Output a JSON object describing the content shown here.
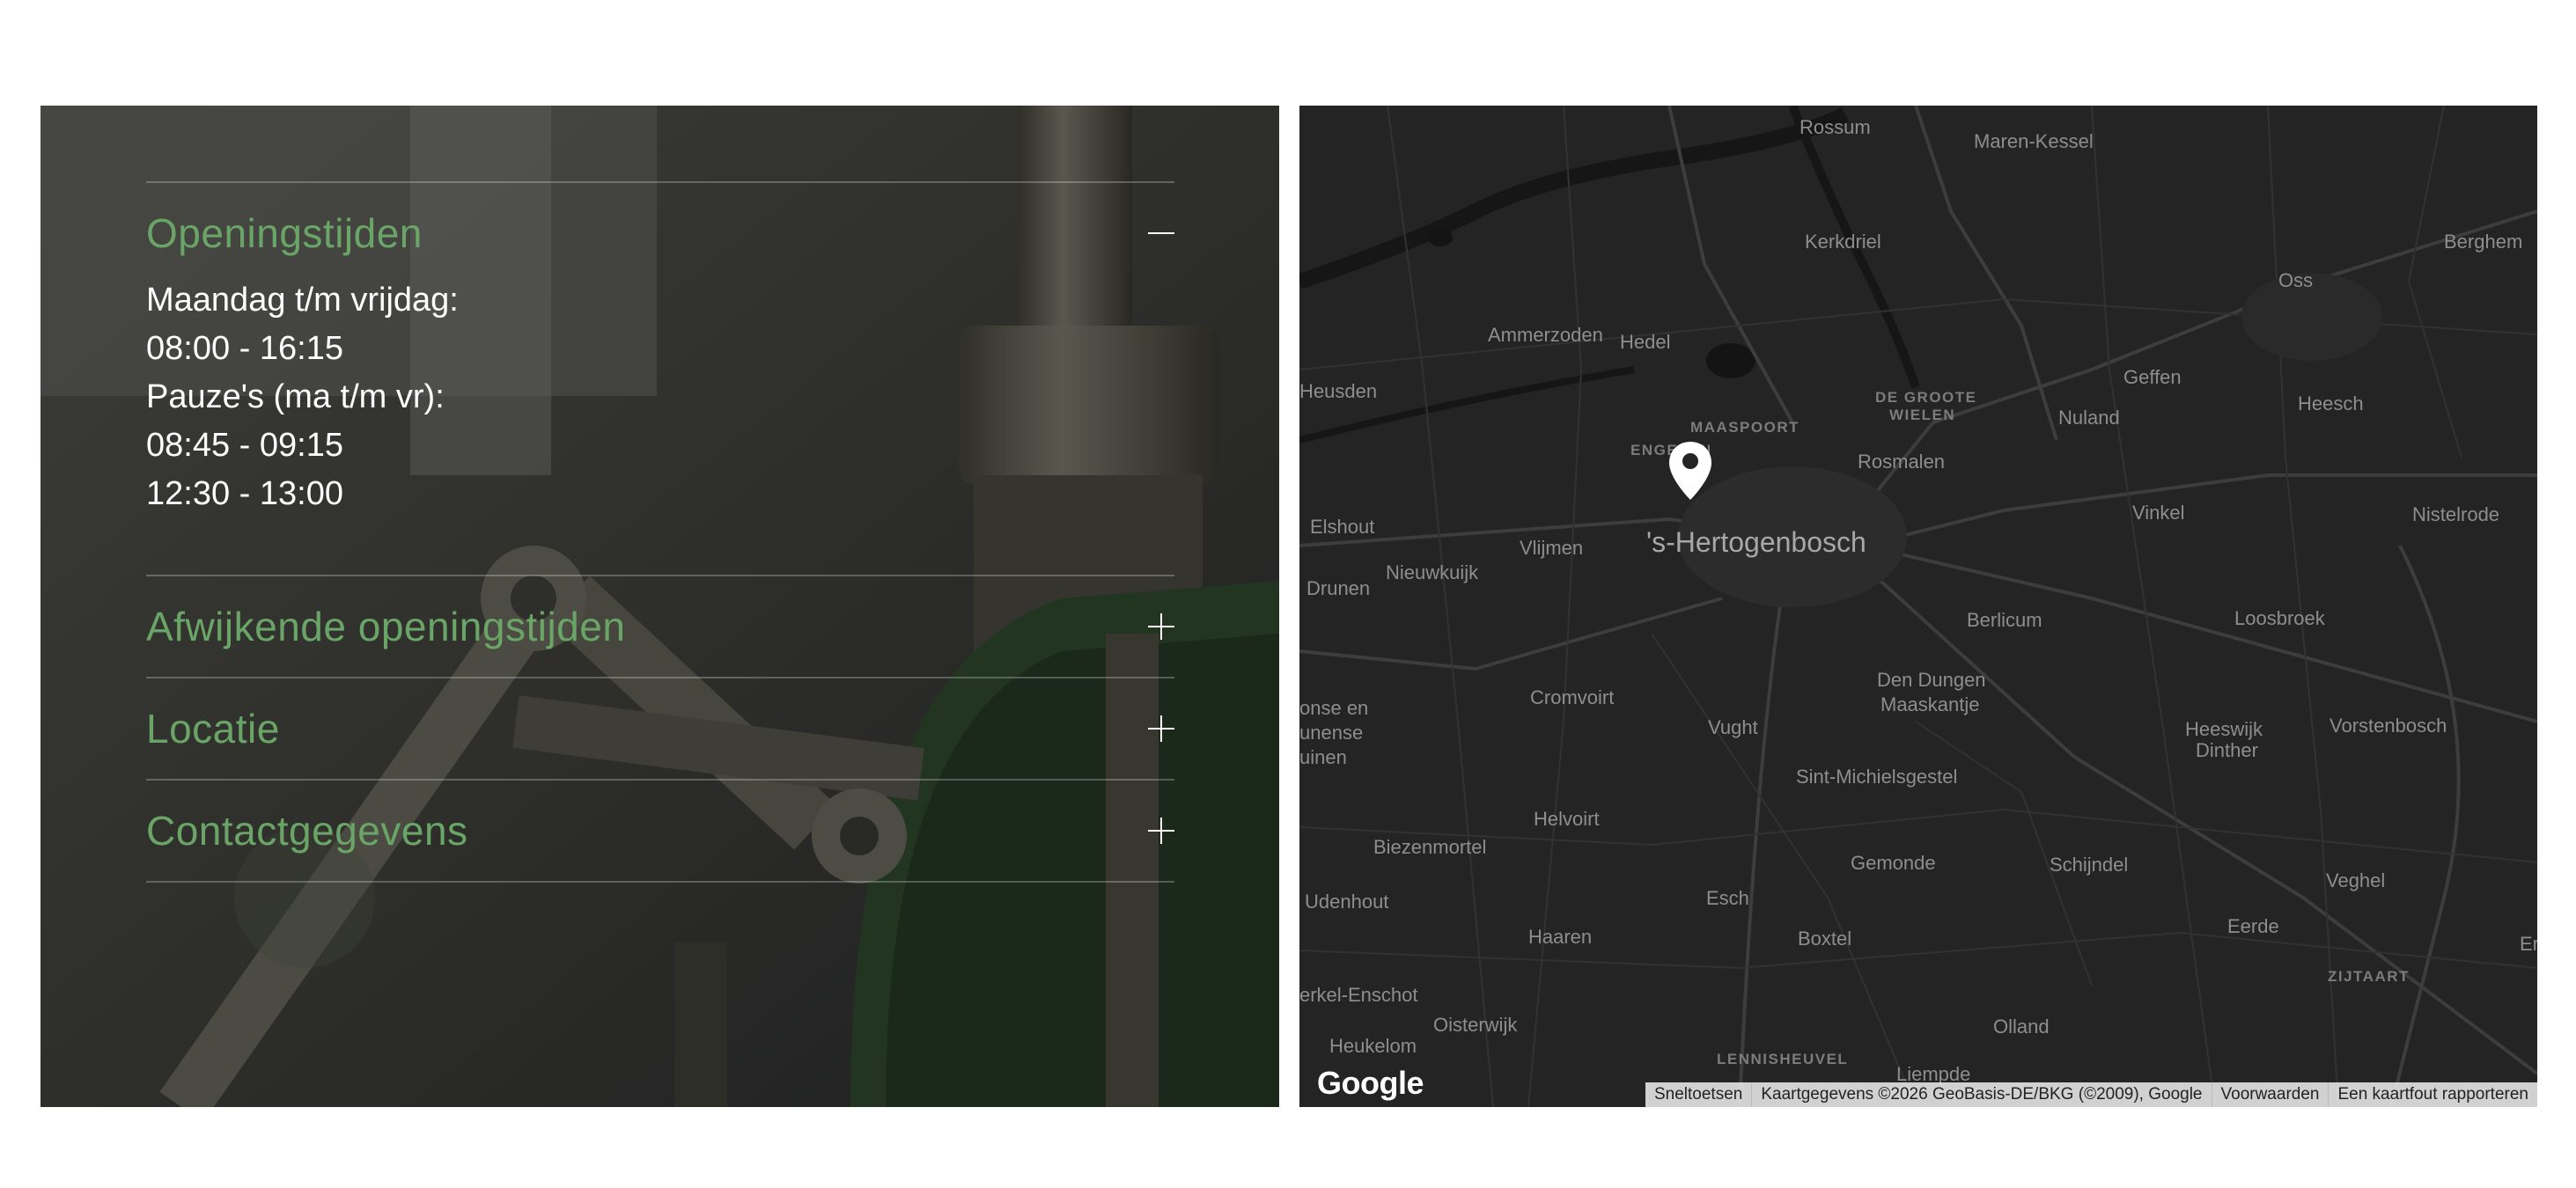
{
  "accordion": {
    "items": [
      {
        "title": "Openingstijden",
        "expanded": true,
        "lines": [
          "Maandag t/m vrijdag:",
          "08:00 - 16:15",
          "Pauze's (ma t/m vr):",
          "08:45 - 09:15",
          "12:30 - 13:00"
        ]
      },
      {
        "title": "Afwijkende openingstijden",
        "expanded": false
      },
      {
        "title": "Locatie",
        "expanded": false
      },
      {
        "title": "Contactgegevens",
        "expanded": false
      }
    ],
    "accent_color": "#6aa567"
  },
  "map": {
    "places": {
      "rossum": "Rossum",
      "maren_kessel": "Maren-Kessel",
      "kerkdriel": "Kerkdriel",
      "berghem": "Berghem",
      "oss": "Oss",
      "ammerzoden": "Ammerzoden",
      "hedel": "Hedel",
      "heusden": "Heusden",
      "de_groote_wielen_1": "DE GROOTE",
      "de_groote_wielen_2": "WIELEN",
      "geffen": "Geffen",
      "heesch": "Heesch",
      "maaspoort": "MAASPOORT",
      "engelen": "ENGELEN",
      "nuland": "Nuland",
      "rosmalen": "Rosmalen",
      "elshout": "Elshout",
      "vlijmen": "Vlijmen",
      "hertogenbosch": "'s-Hertogenbosch",
      "vinkel": "Vinkel",
      "nistelrode": "Nistelrode",
      "drunen": "Drunen",
      "nieuwkuijk": "Nieuwkuijk",
      "berlicum": "Berlicum",
      "loosbroek": "Loosbroek",
      "den_dungen": "Den Dungen",
      "maaskantje": "Maaskantje",
      "cromvoirt": "Cromvoirt",
      "vught": "Vught",
      "heeswijk": "Heeswijk",
      "dinther": "Dinther",
      "vorstenbosch": "Vorstenbosch",
      "loonse_1": "onse en",
      "loonse_2": "unense",
      "loonse_3": "uinen",
      "sint_michielsgestel": "Sint-Michielsgestel",
      "helvoirt": "Helvoirt",
      "biezenmortel": "Biezenmortel",
      "gemonde": "Gemonde",
      "schijndel": "Schijndel",
      "veghel": "Veghel",
      "udenhout": "Udenhout",
      "esch": "Esch",
      "eerde": "Eerde",
      "haaren": "Haaren",
      "boxtel": "Boxtel",
      "er": "Er",
      "zijtaart": "ZIJTAART",
      "kerkel_enschot": "erkel-Enschot",
      "oisterwijk": "Oisterwijk",
      "olland": "Olland",
      "heukelom": "Heukelom",
      "lennisheuvel": "LENNISHEUVEL",
      "liempde": "Liempde"
    },
    "logo": "Google",
    "attribution": [
      "Sneltoetsen",
      "Kaartgegevens ©2026 GeoBasis-DE/BKG (©2009), Google",
      "Voorwaarden",
      "Een kaartfout rapporteren"
    ]
  }
}
